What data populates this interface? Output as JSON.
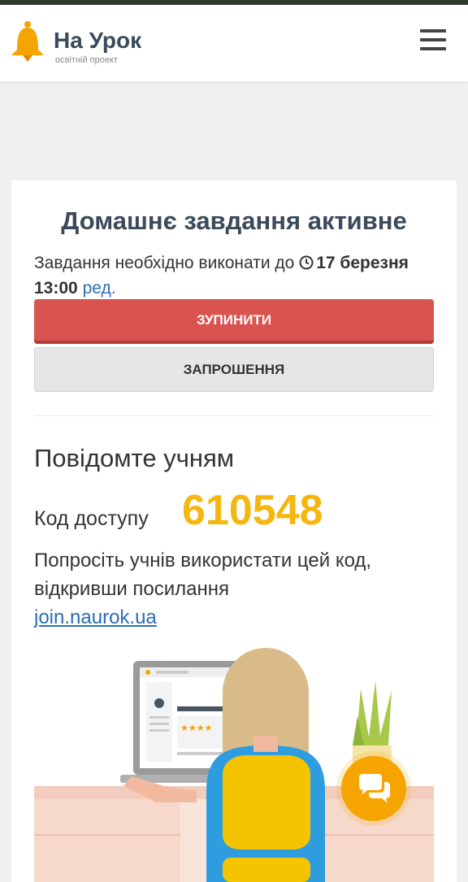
{
  "header": {
    "title": "На Урок",
    "subtitle": "освітній проект",
    "menu_icon": "hamburger-menu-icon"
  },
  "homework": {
    "title": "Домашнє завдання активне",
    "deadline_prefix": "Завдання необхідно виконати до",
    "deadline_date": "17 березня",
    "deadline_time": "13:00",
    "edit_label": "ред.",
    "stop_button": "ЗУПИНИТИ",
    "invite_button": "ЗАПРОШЕННЯ"
  },
  "share": {
    "title": "Повідомте учням",
    "code_label": "Код доступу",
    "code_value": "610548",
    "instructions": "Попросіть учнів використати цей код, відкривши посилання",
    "link": "join.naurok.ua"
  },
  "illustration": {
    "rating_stars": "★★★★"
  },
  "chat": {
    "icon": "chat-bubbles-icon"
  },
  "colors": {
    "brand_dark": "#3b4a5a",
    "accent_yellow": "#f5b70f",
    "stop_red": "#d9534f",
    "link_blue": "#2a6db6",
    "chat_orange": "#f5a400"
  }
}
